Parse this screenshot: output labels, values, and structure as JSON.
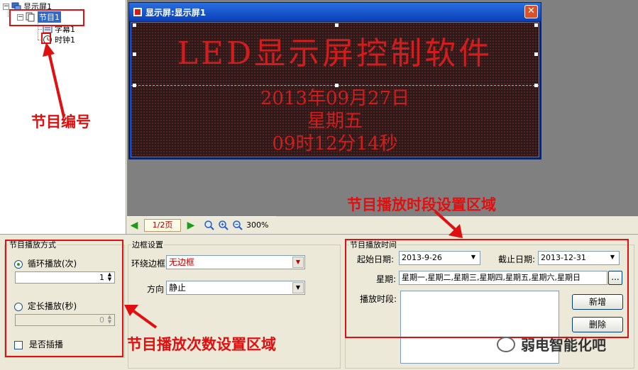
{
  "tree": {
    "root": "显示屏1",
    "program": "节目1",
    "children": [
      "字幕1",
      "时钟1"
    ]
  },
  "preview": {
    "title": "显示屏:显示屏1",
    "close_glyph": "✕",
    "led_line1": "LED显示屏控制软件",
    "led_line2": "2013年09月27日",
    "led_line3": "星期五",
    "led_line4": "09时12分14秒"
  },
  "canvas_toolbar": {
    "prev_glyph": "◀",
    "page": "1/2页",
    "next_glyph": "▶",
    "zoom": "300%"
  },
  "play_mode": {
    "title": "节目播放方式",
    "loop_label": "循环播放(次)",
    "loop_value": "1",
    "fixed_label": "定长播放(秒)",
    "fixed_value": "0",
    "insert_label": "是否插播"
  },
  "border": {
    "title": "边框设置",
    "surround_label": "环绕边框",
    "surround_value": "无边框",
    "direction_label": "方向",
    "direction_value": "静止"
  },
  "schedule": {
    "title": "节目播放时间",
    "start_label": "起始日期:",
    "start_value": "2013-9-26",
    "end_label": "截止日期:",
    "end_value": "2013-12-31",
    "weekday_label": "星期:",
    "weekday_value": "星期一,星期二,星期三,星期四,星期五,星期六,星期日",
    "more_glyph": "...",
    "period_label": "播放时段:",
    "add_button": "新增",
    "delete_button": "删除"
  },
  "annotations": {
    "program_number": "节目编号",
    "time_region": "节目播放时段设置区域",
    "count_region": "节目播放次数设置区域"
  },
  "watermark": "弱电智能化吧",
  "colors": {
    "annotation": "#e01010",
    "led_text": "#d21d1d",
    "selection": "#316ac5"
  }
}
